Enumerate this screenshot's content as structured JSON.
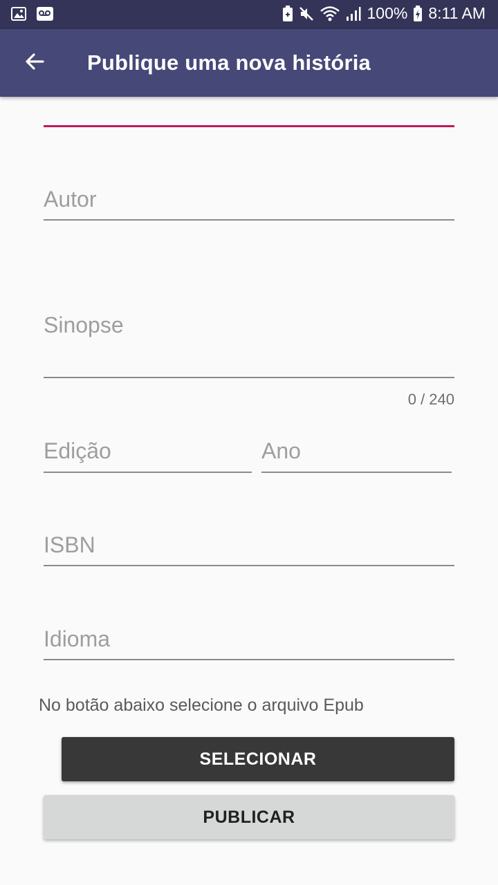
{
  "status_bar": {
    "battery": "100%",
    "time": "8:11 AM",
    "icons": [
      "image-icon",
      "voicemail-icon",
      "battery-saver-icon",
      "mute-icon",
      "wifi-icon",
      "signal-icon",
      "battery-charging-icon"
    ]
  },
  "app_bar": {
    "title": "Publique uma nova história",
    "back_icon": "arrow-back-icon"
  },
  "form": {
    "title_field": {
      "value": "",
      "focused": true,
      "accent": "#c2185b"
    },
    "author": {
      "placeholder": "Autor"
    },
    "synopsis": {
      "placeholder": "Sinopse",
      "counter": "0 / 240"
    },
    "edition": {
      "placeholder": "Edição"
    },
    "year": {
      "placeholder": "Ano"
    },
    "isbn": {
      "placeholder": "ISBN"
    },
    "language": {
      "placeholder": "Idioma"
    },
    "hint": "No botão abaixo selecione o arquivo Epub",
    "select_label": "SELECIONAR",
    "publish_label": "PUBLICAR"
  },
  "colors": {
    "status_bar": "#343458",
    "app_bar": "#464878",
    "select_button": "#383838",
    "publish_button": "#d6d7d7"
  }
}
